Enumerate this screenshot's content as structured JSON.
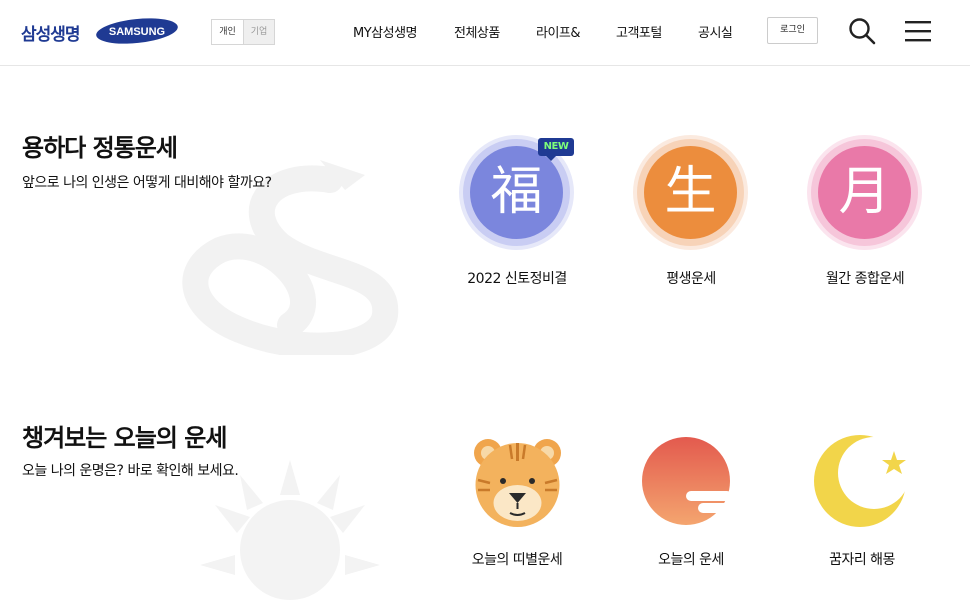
{
  "header": {
    "brand_ko": "삼성생명",
    "brand_logo": "SAMSUNG",
    "segment": [
      "개인",
      "기업"
    ],
    "nav": [
      "MY삼성생명",
      "전체상품",
      "라이프&",
      "고객포털",
      "공시실"
    ],
    "login_label": "로그인",
    "icons": [
      "search-icon",
      "menu-icon"
    ]
  },
  "sections": [
    {
      "title": "용하다 정통운세",
      "desc": "앞으로 나의 인생은 어떻게 대비해야 할까요?",
      "items": [
        {
          "label": "2022 신토정비결",
          "glyph": "福",
          "badge": "NEW"
        },
        {
          "label": "평생운세",
          "glyph": "生"
        },
        {
          "label": "월간 종합운세",
          "glyph": "月"
        }
      ]
    },
    {
      "title": "챙겨보는 오늘의 운세",
      "desc": "오늘 나의 운명은? 바로 확인해 보세요.",
      "items": [
        {
          "label": "오늘의 띠별운세",
          "icon": "tiger-icon"
        },
        {
          "label": "오늘의 운세",
          "icon": "sun-cloud-icon"
        },
        {
          "label": "꿈자리 해몽",
          "icon": "moon-star-icon"
        }
      ]
    }
  ],
  "colors": {
    "brand_blue": "#1f3a93",
    "purple": "#7b86dd",
    "orange": "#ec8d3d",
    "pink": "#e979a8"
  }
}
